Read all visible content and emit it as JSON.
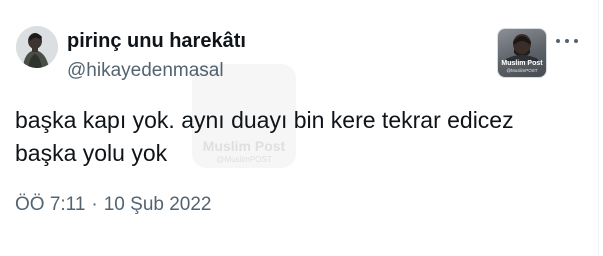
{
  "tweet": {
    "display_name": "pirinç unu harekâtı",
    "handle": "@hikayedenmasal",
    "text_lines": [
      "başka kapı yok. aynı duayı bin kere tekrar edicez",
      "başka yolu yok"
    ],
    "time": "ÖÖ 7:11",
    "separator": "·",
    "date": "10 Şub 2022",
    "more_icon": "more-horizontal-icon"
  },
  "watermark": {
    "brand": "Muslim Post",
    "handle": "@MuslimPOST"
  },
  "colors": {
    "text_primary": "#0f1419",
    "text_secondary": "#536471",
    "background": "#ffffff"
  }
}
